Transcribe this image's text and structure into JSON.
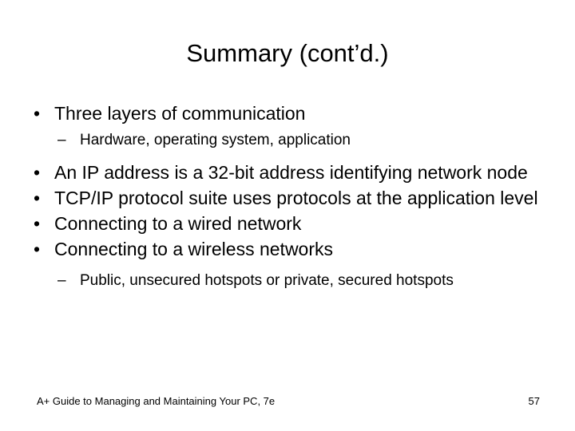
{
  "slide": {
    "title": "Summary (cont’d.)",
    "bullet_marker": "•",
    "sub_bullet_marker": "–",
    "bullets": [
      {
        "level": 1,
        "text": "Three layers of communication"
      },
      {
        "level": 2,
        "text": "Hardware, operating system, application"
      },
      {
        "level": 1,
        "text": "An IP address is a 32-bit address identifying network node"
      },
      {
        "level": 1,
        "text": "TCP/IP protocol suite uses protocols at the application level"
      },
      {
        "level": 1,
        "text": "Connecting to a wired network"
      },
      {
        "level": 1,
        "text": "Connecting to a wireless networks"
      },
      {
        "level": 2,
        "text": "Public, unsecured hotspots or private, secured hotspots"
      }
    ]
  },
  "footer": {
    "text": "A+ Guide to Managing and Maintaining Your PC, 7e",
    "page_number": "57"
  },
  "colors": {
    "background": "#ffffff",
    "text": "#000000"
  }
}
